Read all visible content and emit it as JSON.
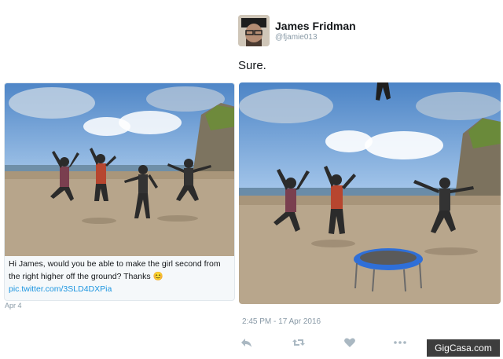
{
  "original_tweet": {
    "caption": "Hi James, would you be able to make the girl second from the right higher off the ground? Thanks",
    "emoji": "😊",
    "link": "pic.twitter.com/3SLD4DXPia",
    "date": "Apr 4"
  },
  "reply_tweet": {
    "author_name": "James Fridman",
    "author_handle": "@fjamie013",
    "text": "Sure.",
    "timestamp": "2:45 PM - 17 Apr 2016",
    "actions": [
      {
        "name": "reply-icon"
      },
      {
        "name": "retweet-icon"
      },
      {
        "name": "like-icon"
      },
      {
        "name": "more-icon"
      }
    ]
  },
  "watermark": "GigCasa.com",
  "colors": {
    "link": "#1b95e0",
    "muted": "#8899a6",
    "icon": "#aab8c2",
    "sky": "#5f95d0",
    "sand": "#b5a38a",
    "trampoline": "#2f6fd8"
  }
}
